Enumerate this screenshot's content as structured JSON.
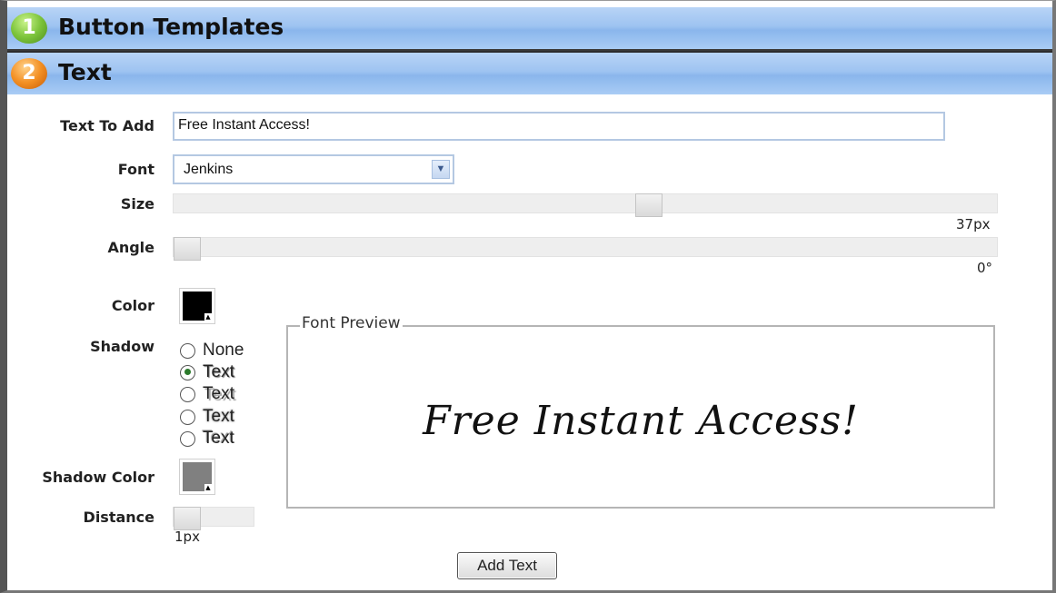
{
  "sections": [
    {
      "number": "1",
      "title": "Button Templates"
    },
    {
      "number": "2",
      "title": "Text"
    }
  ],
  "form": {
    "text_to_add": {
      "label": "Text To Add",
      "value": "Free Instant Access!"
    },
    "font": {
      "label": "Font",
      "selected": "Jenkins"
    },
    "size": {
      "label": "Size",
      "value_text": "37px",
      "level": 0.58
    },
    "angle": {
      "label": "Angle",
      "value_text": "0°",
      "level": 0.0
    },
    "color": {
      "label": "Color",
      "hex": "#000000"
    },
    "shadow": {
      "label": "Shadow",
      "options": [
        "None",
        "Text",
        "Text",
        "Text",
        "Text"
      ],
      "selected_index": 1
    },
    "shadow_color": {
      "label": "Shadow Color",
      "hex": "#808080"
    },
    "distance": {
      "label": "Distance",
      "value_text": "1px",
      "level": 0.0
    }
  },
  "preview": {
    "legend": "Font Preview",
    "text": "Free Instant Access!"
  },
  "actions": {
    "add_text_label": "Add Text"
  },
  "colors": {
    "header_blue": "#9ec3f1",
    "badge_green": "#7dc43b",
    "badge_orange": "#f39024"
  }
}
